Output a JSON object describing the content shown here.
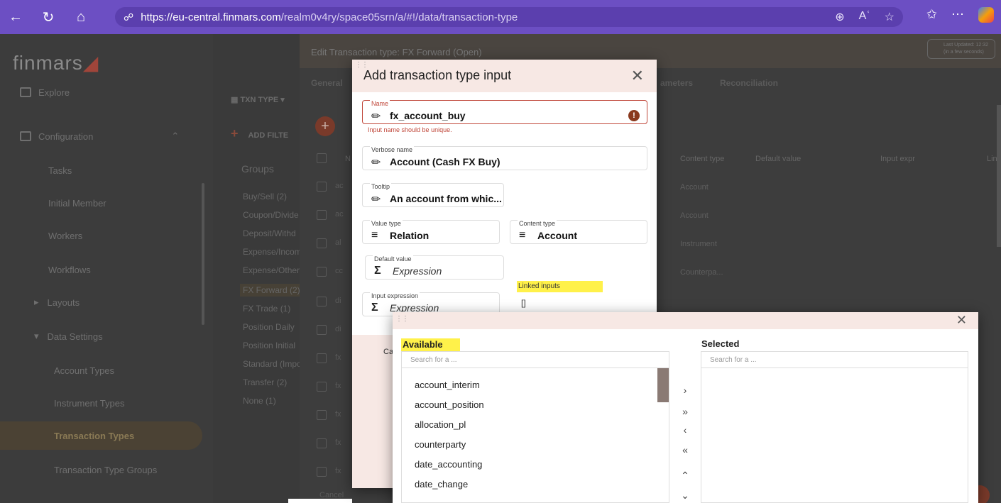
{
  "browser": {
    "url_host": "https://eu-central.finmars.com",
    "url_path": "/realm0v4ry/space05srn/a/#!/data/transaction-type"
  },
  "app": {
    "logo": "finmars",
    "sidebar": [
      {
        "label": "Explore"
      },
      {
        "label": "Configuration"
      },
      {
        "label": "Tasks"
      },
      {
        "label": "Initial Member"
      },
      {
        "label": "Workers"
      },
      {
        "label": "Workflows"
      },
      {
        "label": "Layouts"
      },
      {
        "label": "Data Settings"
      },
      {
        "label": "Account Types"
      },
      {
        "label": "Instrument Types"
      },
      {
        "label": "Transaction Types"
      },
      {
        "label": "Transaction Type Groups"
      }
    ],
    "txn_type_btn": "TXN TYPE",
    "add_filter": "ADD FILTE",
    "groups_title": "Groups",
    "groups": [
      "Buy/Sell (2)",
      "Coupon/Divide",
      "Deposit/Withd",
      "Expense/Incom",
      "Expense/Other",
      "FX Forward (2)",
      "FX Trade (1)",
      "Position Daily",
      "Position Initial",
      "Standard (Impo",
      "Transfer (2)",
      "None (1)"
    ],
    "edit_title": "Edit Transaction type: FX Forward (Open)",
    "last_updated": "Last Updated: 12:32 (in a few seconds)",
    "tabs": [
      {
        "label": "General"
      },
      {
        "label": "ameters"
      },
      {
        "label": "Reconciliation"
      }
    ],
    "columns": [
      "N",
      "Content type",
      "Default value",
      "Input expr",
      "Lin"
    ],
    "rows": [
      {
        "letter": "ac",
        "content": "Account"
      },
      {
        "letter": "ac",
        "content": "Account"
      },
      {
        "letter": "al",
        "content": "Instrument"
      },
      {
        "letter": "cc",
        "content": "Counterpa..."
      },
      {
        "letter": "di",
        "content": ""
      },
      {
        "letter": "di",
        "content": ""
      },
      {
        "letter": "fx",
        "content": ""
      },
      {
        "letter": "fx",
        "content": ""
      },
      {
        "letter": "fx",
        "content": ""
      },
      {
        "letter": "fx",
        "content": ""
      },
      {
        "letter": "fx",
        "content": ""
      }
    ],
    "cancel_under": "Cancel"
  },
  "dialog1": {
    "title": "Add transaction type input",
    "name_label": "Name",
    "name_value": "fx_account_buy",
    "name_error": "Input name should be unique.",
    "verbose_label": "Verbose name",
    "verbose_value": "Account (Cash FX Buy)",
    "tooltip_label": "Tooltip",
    "tooltip_value": "An account from whic...",
    "value_type_label": "Value type",
    "value_type_value": "Relation",
    "content_type_label": "Content type",
    "content_type_value": "Account",
    "default_label": "Default value",
    "default_value": "Expression",
    "input_expr_label": "Input expression",
    "input_expr_value": "Expression",
    "linked_label": "Linked inputs",
    "linked_value": "[]",
    "cancel": "Ca"
  },
  "dialog2": {
    "available_title": "Available",
    "selected_title": "Selected",
    "search_placeholder": "Search for a ...",
    "available_items": [
      "account_interim",
      "account_position",
      "allocation_pl",
      "counterparty",
      "date_accounting",
      "date_change"
    ]
  },
  "colors": {
    "browser": "#6c4fc3",
    "accent": "#8a3a1e",
    "error": "#c0473a",
    "highlight": "#fff14a",
    "dialog_header": "#f7e8e4"
  }
}
